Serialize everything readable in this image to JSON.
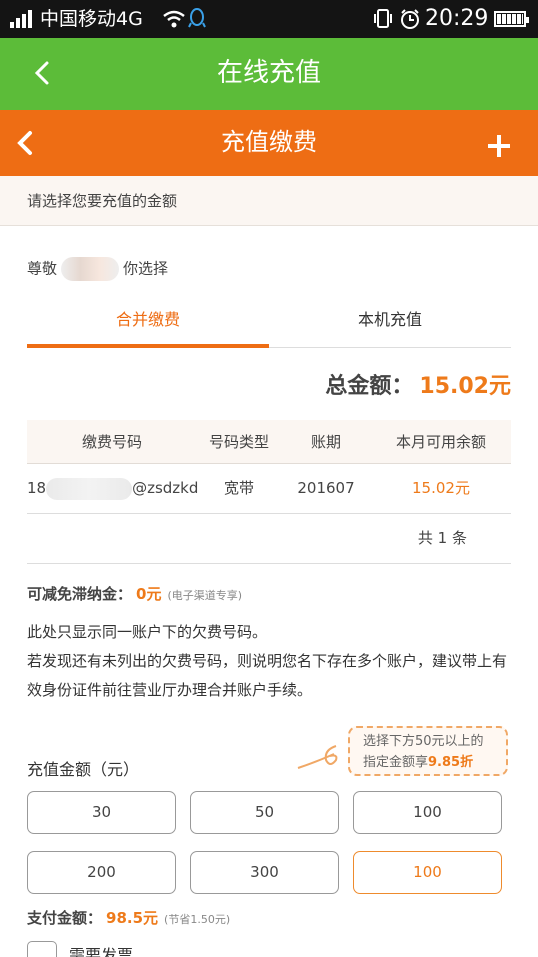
{
  "status_bar": {
    "carrier": "中国移动4G",
    "time": "20:29"
  },
  "outer_header": {
    "title": "在线充值"
  },
  "inner_header": {
    "title": "充值缴费"
  },
  "tip": "请选择您要充值的金额",
  "greeting": {
    "prefix": "尊敬",
    "suffix": "你选择"
  },
  "tabs": [
    "合并缴费",
    "本机充值"
  ],
  "total": {
    "label": "总金额：",
    "value": "15.02元"
  },
  "table": {
    "headers": [
      "缴费号码",
      "号码类型",
      "账期",
      "本月可用余额"
    ],
    "rows": [
      {
        "number_prefix": "18",
        "number_suffix": "@zsdzkd",
        "type": "宽带",
        "period": "201607",
        "balance": "15.02元"
      }
    ],
    "count": "共 1 条"
  },
  "late_fee": {
    "label": "可减免滞纳金：",
    "value": "0元",
    "note": "(电子渠道专享)"
  },
  "notes": [
    "此处只显示同一账户下的欠费号码。",
    "若发现还有未列出的欠费号码，则说明您名下存在多个账户，建议带上有效身份证件前往营业厅办理合并账户手续。"
  ],
  "recharge": {
    "label": "充值金额（元）",
    "promo_line1": "选择下方50元以上的",
    "promo_line2_prefix": "指定金额享",
    "promo_discount": "9.85折",
    "options": [
      "30",
      "50",
      "100",
      "200",
      "300",
      "100"
    ],
    "selected_index": 5
  },
  "payment": {
    "label": "支付金额：",
    "value": "98.5元",
    "note": "(节省1.50元)"
  },
  "invoice": {
    "label": "需要发票",
    "checked": false
  },
  "colors": {
    "green": "#5cbc39",
    "orange": "#ee6d14",
    "accent": "#ee7a1a"
  }
}
